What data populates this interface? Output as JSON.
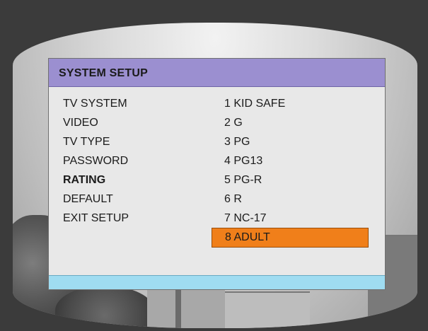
{
  "menu": {
    "title": "SYSTEM SETUP",
    "left_items": [
      {
        "label": "TV SYSTEM"
      },
      {
        "label": "VIDEO"
      },
      {
        "label": "TV TYPE"
      },
      {
        "label": "PASSWORD"
      },
      {
        "label": "RATING",
        "active": true
      },
      {
        "label": "DEFAULT"
      },
      {
        "label": "EXIT SETUP"
      }
    ],
    "right_items": [
      {
        "label": "1 KID SAFE"
      },
      {
        "label": "2 G"
      },
      {
        "label": "3 PG"
      },
      {
        "label": "4 PG13"
      },
      {
        "label": "5 PG-R"
      },
      {
        "label": "6 R"
      },
      {
        "label": "7 NC-17"
      },
      {
        "label": "8 ADULT",
        "selected": true
      }
    ]
  },
  "colors": {
    "title_bar": "#9b8fd0",
    "menu_background": "#e8e8e8",
    "selected_highlight": "#f07f1a",
    "bottom_bar": "#9fdcf1",
    "outer_frame": "#3b3b3b"
  }
}
